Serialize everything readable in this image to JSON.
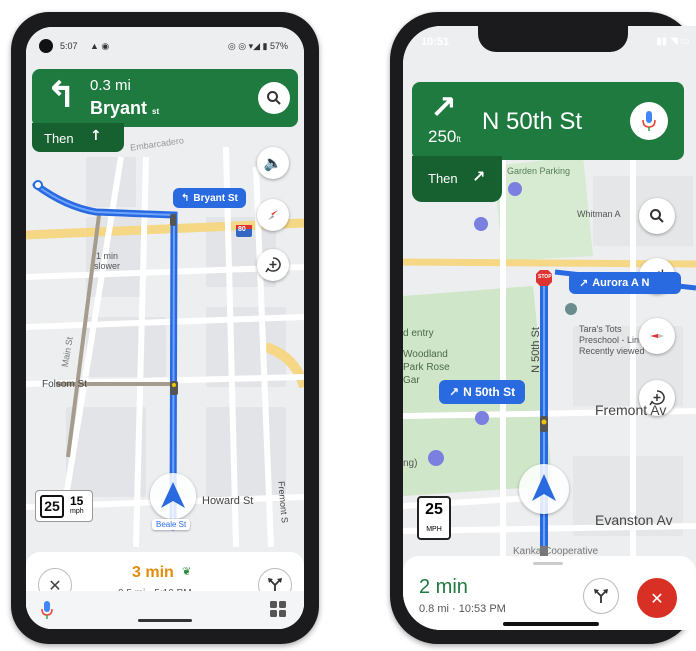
{
  "phone1": {
    "status": {
      "time": "5:07",
      "left_icons": "▲ ◉",
      "right_icons": "◎ ◎ ▾◢ ▮ 57%"
    },
    "direction": {
      "distance": "0.3 mi",
      "street": "Bryant",
      "street_suffix": "st",
      "then_label": "Then"
    },
    "map_labels": {
      "folsom": "Folsom St",
      "howard": "Howard St",
      "fremont": "Fremont S",
      "main": "Main St",
      "slower_1": "1 min",
      "slower_2": "slower",
      "beale": "Beale St",
      "embarcadero": "Embarcadero",
      "hwy": "80",
      "route_callout": "Bryant St"
    },
    "speed": {
      "limit": "25",
      "current": "15",
      "unit": "mph"
    },
    "trip": {
      "time": "3 min",
      "details": "0.5 mi • 5:10 PM"
    },
    "colors": {
      "time": "#e48b0c",
      "route": "#2a6ae0",
      "banner": "#1f7a3f"
    }
  },
  "phone2": {
    "status": {
      "time": "10:51",
      "right_icons": "▮▮ ◥ ▭"
    },
    "direction": {
      "distance": "250",
      "unit": "ft",
      "street": "N 50th St",
      "then_label": "Then"
    },
    "map_labels": {
      "garden_parking": "Garden Parking",
      "whitman": "Whitman A",
      "aurora": "Aurora A N",
      "taras_1": "Tara's Tots",
      "taras_2": "Preschool - Lin",
      "taras_3": "Recently viewed",
      "entry": "d entry",
      "woodland_1": "Woodland",
      "woodland_2": "Park Rose",
      "woodland_3": "Gar",
      "n50_vertical": "N 50th St",
      "fremont": "Fremont Av",
      "evanston": "Evanston Av",
      "zoo": "ng)",
      "kanka": "Kanka Cooperative",
      "route_callout": "N 50th St",
      "stop": "STOP"
    },
    "speed": {
      "limit": "25",
      "unit": "MPH"
    },
    "trip": {
      "time": "2 min",
      "details": "0.8 mi · 10:53 PM"
    },
    "colors": {
      "time": "#1f7a3f",
      "route": "#2a6ae0",
      "end_button": "#d93025"
    }
  }
}
